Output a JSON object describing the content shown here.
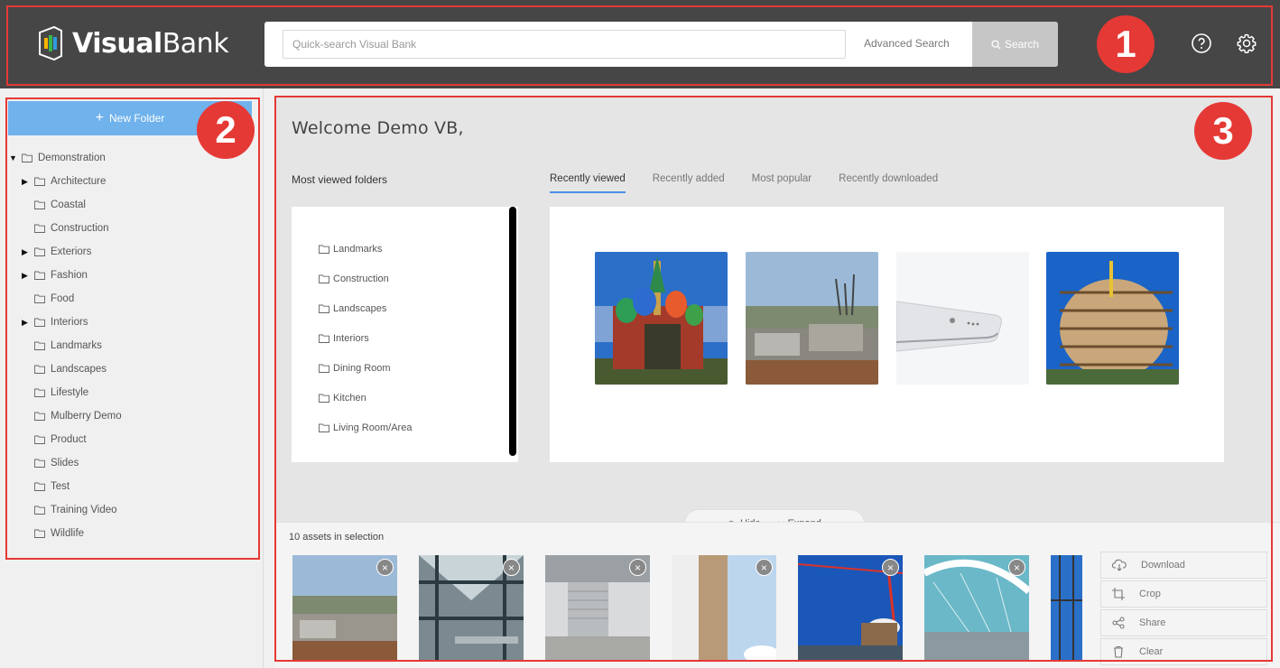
{
  "header": {
    "logo_bold": "Visual",
    "logo_light": "Bank",
    "search_placeholder": "Quick-search Visual Bank",
    "advanced_search_label": "Advanced Search",
    "search_button_label": "Search",
    "icons": [
      "help-circle-icon",
      "gear-icon"
    ]
  },
  "callouts": [
    "1",
    "2",
    "3"
  ],
  "sidebar": {
    "new_folder_label": "New Folder",
    "root": "Demonstration",
    "items": [
      {
        "label": "Architecture",
        "expandable": true
      },
      {
        "label": "Coastal",
        "expandable": false
      },
      {
        "label": "Construction",
        "expandable": false
      },
      {
        "label": "Exteriors",
        "expandable": true
      },
      {
        "label": "Fashion",
        "expandable": true
      },
      {
        "label": "Food",
        "expandable": false
      },
      {
        "label": "Interiors",
        "expandable": true
      },
      {
        "label": "Landmarks",
        "expandable": false
      },
      {
        "label": "Landscapes",
        "expandable": false
      },
      {
        "label": "Lifestyle",
        "expandable": false
      },
      {
        "label": "Mulberry Demo",
        "expandable": false
      },
      {
        "label": "Product",
        "expandable": false
      },
      {
        "label": "Slides",
        "expandable": false
      },
      {
        "label": "Test",
        "expandable": false
      },
      {
        "label": "Training Video",
        "expandable": false
      },
      {
        "label": "Wildlife",
        "expandable": false
      }
    ]
  },
  "main": {
    "welcome": "Welcome Demo VB,",
    "most_viewed_title": "Most viewed folders",
    "most_viewed": [
      "Landmarks",
      "Construction",
      "Landscapes",
      "Interiors",
      "Dining Room",
      "Kitchen",
      "Living Room/Area"
    ],
    "tabs": [
      {
        "label": "Recently viewed",
        "active": true
      },
      {
        "label": "Recently added",
        "active": false
      },
      {
        "label": "Most popular",
        "active": false
      },
      {
        "label": "Recently downloaded",
        "active": false
      }
    ]
  },
  "selection": {
    "hide_label": "Hide",
    "expand_label": "Expand",
    "count_text": "10 assets in selection",
    "actions": [
      "Download",
      "Crop",
      "Share",
      "Clear"
    ]
  },
  "colors": {
    "header_bg": "#464646",
    "accent": "#6fb2ec",
    "callout_red": "#e53935"
  }
}
